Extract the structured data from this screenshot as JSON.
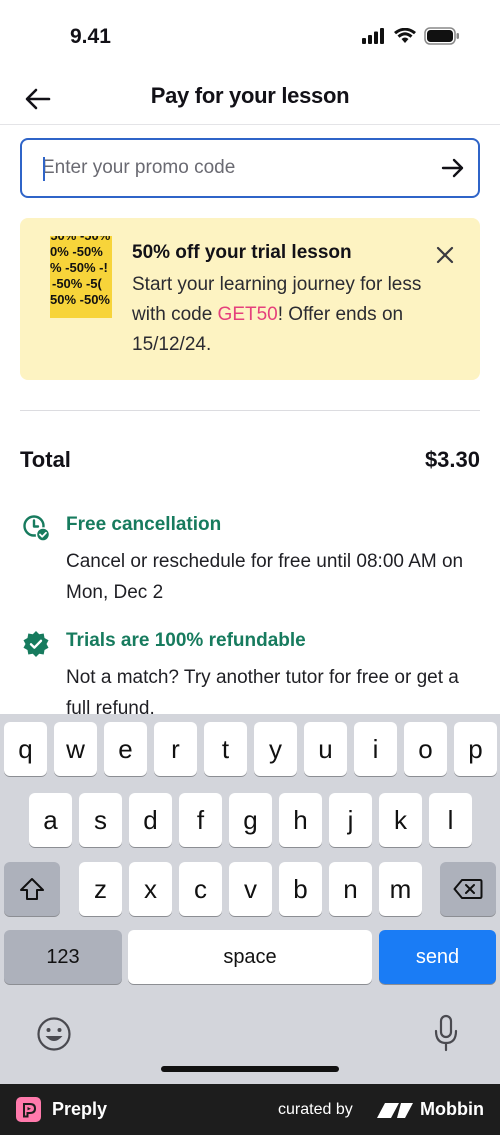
{
  "status_bar": {
    "time": "9.41"
  },
  "header": {
    "title": "Pay for your lesson"
  },
  "promo": {
    "placeholder": "Enter your promo code"
  },
  "banner": {
    "image_rows": [
      "-50% -50%",
      "0% -50%",
      "% -50% -!",
      "-50% -5(",
      "50% -50%"
    ],
    "title": "50% off your trial lesson",
    "body_before": "Start your learning journey for less with code ",
    "code": "GET50",
    "body_after": "! Offer ends on 15/12/24."
  },
  "total": {
    "label": "Total",
    "value": "$3.30"
  },
  "features": [
    {
      "icon": "clock-check-icon",
      "title": "Free cancellation",
      "body": "Cancel or reschedule for free until 08:00 AM on Mon, Dec 2"
    },
    {
      "icon": "shield-check-icon",
      "title": "Trials are 100% refundable",
      "body": "Not a match? Try another tutor for free or get a full refund."
    }
  ],
  "keyboard": {
    "row1": [
      "q",
      "w",
      "e",
      "r",
      "t",
      "y",
      "u",
      "i",
      "o",
      "p"
    ],
    "row2": [
      "a",
      "s",
      "d",
      "f",
      "g",
      "h",
      "j",
      "k",
      "l"
    ],
    "row3": [
      "z",
      "x",
      "c",
      "v",
      "b",
      "n",
      "m"
    ],
    "numbers_label": "123",
    "space_label": "space",
    "send_label": "send"
  },
  "footer": {
    "brand": "Preply",
    "curated_by": "curated by",
    "curator": "Mobbin"
  },
  "colors": {
    "accent": "#2f64c8",
    "banner": "#fdf3c2",
    "promo_code": "#e5407c",
    "green": "#177b5e",
    "send": "#1a7cf5"
  }
}
